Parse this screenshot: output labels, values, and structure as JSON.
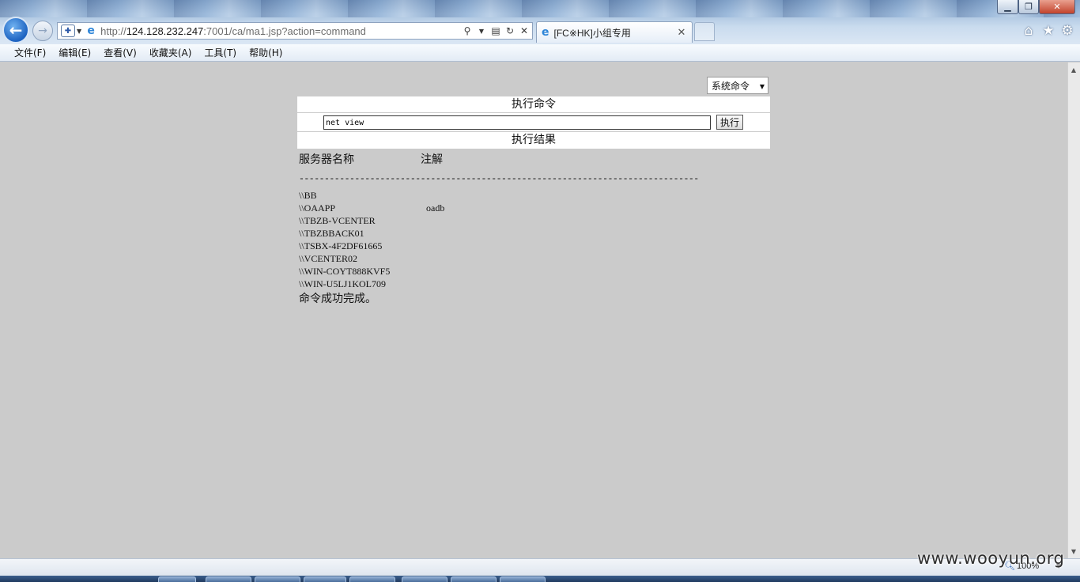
{
  "window": {
    "minimize_glyph": "▁",
    "maximize_glyph": "❐",
    "close_glyph": "✕"
  },
  "nav": {
    "back_icon": "arrow-left",
    "forward_icon": "arrow-right"
  },
  "address_bar": {
    "url_prefix": "http://",
    "url_host": "124.128.232.247",
    "url_rest": ":7001/ca/ma1.jsp?action=command"
  },
  "tab": {
    "title": "[FC※HK]小组专用",
    "close_glyph": "✕"
  },
  "menu": [
    {
      "label": "文件(F)"
    },
    {
      "label": "编辑(E)"
    },
    {
      "label": "查看(V)"
    },
    {
      "label": "收藏夹(A)"
    },
    {
      "label": "工具(T)"
    },
    {
      "label": "帮助(H)"
    }
  ],
  "page": {
    "type_select": {
      "value": "系统命令"
    },
    "panel": {
      "heading": "执行命令",
      "command_value": "net view",
      "exec_button": "执行",
      "result_heading": "执行结果"
    },
    "result": {
      "col_server": "服务器名称",
      "col_remark": "注解",
      "separator": "-------------------------------------------------------------------------------",
      "servers": [
        {
          "name": "\\\\BB",
          "remark": ""
        },
        {
          "name": "\\\\OAAPP",
          "remark": "oadb"
        },
        {
          "name": "\\\\TBZB-VCENTER",
          "remark": ""
        },
        {
          "name": "\\\\TBZBBACK01",
          "remark": ""
        },
        {
          "name": "\\\\TSBX-4F2DF61665",
          "remark": ""
        },
        {
          "name": "\\\\VCENTER02",
          "remark": ""
        },
        {
          "name": "\\\\WIN-COYT888KVF5",
          "remark": ""
        },
        {
          "name": "\\\\WIN-U5LJ1KOL709",
          "remark": ""
        }
      ],
      "done_message": "命令成功完成。"
    }
  },
  "statusbar": {
    "zoom": "100%"
  },
  "watermark": "www.wooyun.org"
}
